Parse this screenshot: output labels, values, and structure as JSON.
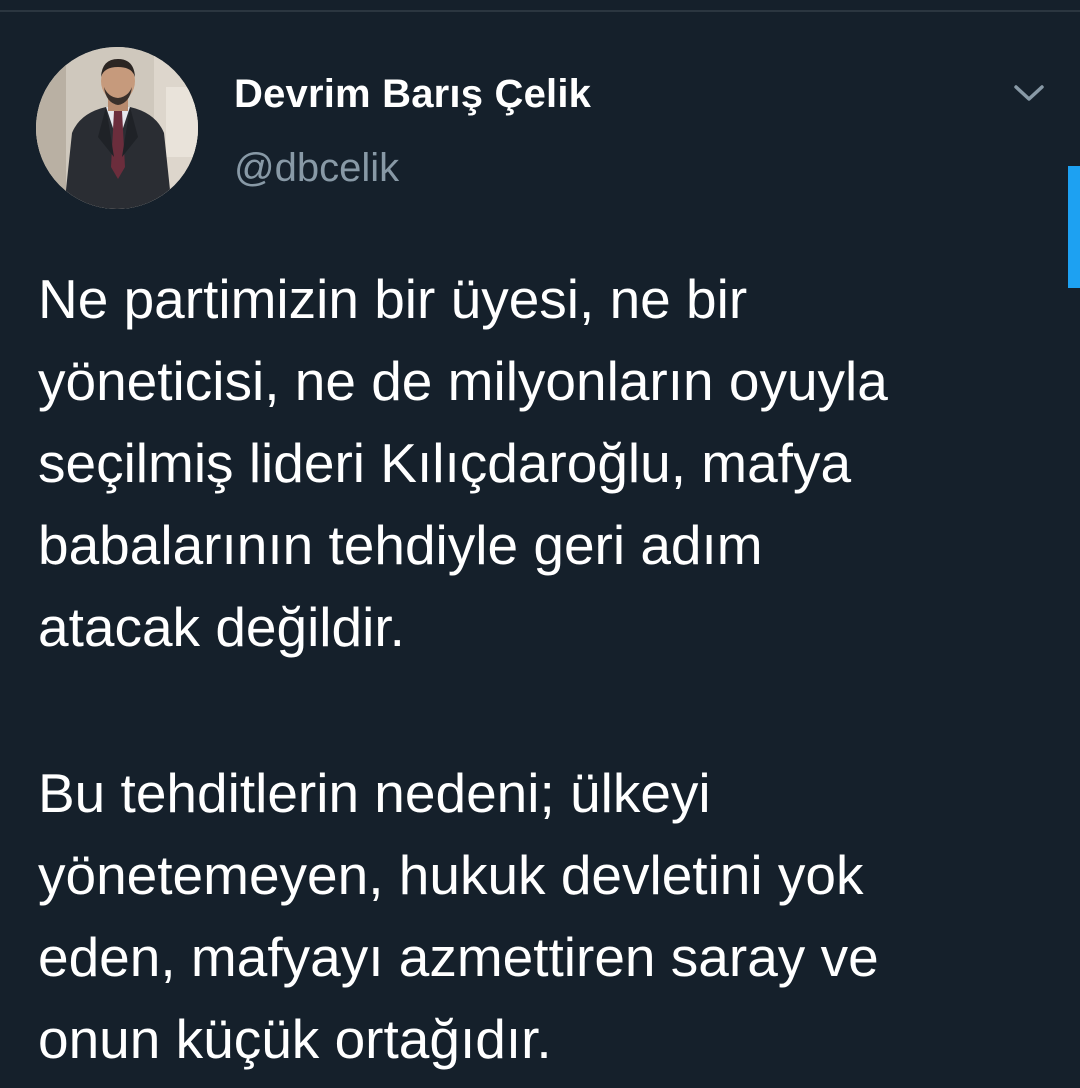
{
  "tweet": {
    "author": {
      "display_name": "Devrim Barış Çelik",
      "handle": "@dbcelik",
      "avatar_icon": "profile-photo"
    },
    "menu_icon": "chevron-down-icon",
    "paragraphs": [
      {
        "lines": [
          "Ne partimizin bir üyesi, ne bir",
          "yöneticisi, ne de milyonların oyuyla",
          "seçilmiş lideri Kılıçdaroğlu, mafya",
          "babalarının tehdiyle geri adım",
          "atacak değildir."
        ]
      },
      {
        "lines": [
          "Bu tehditlerin nedeni; ülkeyi",
          "yönetemeyen, hukuk devletini yok",
          "eden, mafyayı azmettiren saray ve",
          "onun küçük ortağıdır."
        ]
      }
    ]
  },
  "colors": {
    "background": "#15202b",
    "text": "#ffffff",
    "secondary_text": "#8899a6",
    "accent": "#1da1f2"
  }
}
